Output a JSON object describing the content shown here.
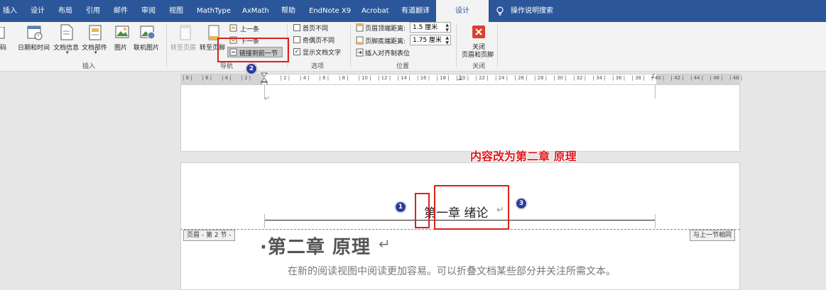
{
  "tabs": [
    {
      "label": "插入",
      "active": false
    },
    {
      "label": "设计",
      "active": false
    },
    {
      "label": "布局",
      "active": false
    },
    {
      "label": "引用",
      "active": false
    },
    {
      "label": "邮件",
      "active": false
    },
    {
      "label": "审阅",
      "active": false
    },
    {
      "label": "视图",
      "active": false
    },
    {
      "label": "MathType",
      "active": false
    },
    {
      "label": "AxMath",
      "active": false
    },
    {
      "label": "帮助",
      "active": false
    },
    {
      "label": "EndNote X9",
      "active": false
    },
    {
      "label": "Acrobat",
      "active": false
    },
    {
      "label": "有道翻译",
      "active": false
    },
    {
      "label": "设计",
      "active": true
    }
  ],
  "search_label": "操作说明搜索",
  "ribbon": {
    "insert_group": {
      "left_cut_label": "码",
      "buttons": [
        "日期和时间",
        "文档信息",
        "文档部件",
        "图片",
        "联机图片"
      ],
      "label": "插入"
    },
    "nav_group": {
      "goto_header": "转至页眉",
      "goto_footer": "转至页脚",
      "prev": "上一条",
      "next": "下一条",
      "link_prev": "链接到前一节",
      "label": "导航"
    },
    "options_group": {
      "checkboxes": [
        {
          "label": "首页不同",
          "checked": false
        },
        {
          "label": "奇偶页不同",
          "checked": false
        },
        {
          "label": "显示文档文字",
          "checked": true
        }
      ],
      "label": "选项"
    },
    "position_group": {
      "header_top_label": "页眉顶端距离:",
      "header_top_value": "1.5 厘米",
      "footer_bottom_label": "页脚底端距离:",
      "footer_bottom_value": "1.75 厘米",
      "align_tab": "插入对齐制表位",
      "label": "位置"
    },
    "close_group": {
      "close_line1": "关闭",
      "close_line2": "页眉和页脚",
      "label": "关闭"
    }
  },
  "ruler_numbers": [
    "8",
    "6",
    "4",
    "2",
    "",
    "2",
    "4",
    "6",
    "8",
    "10",
    "12",
    "14",
    "16",
    "18",
    "20",
    "22",
    "24",
    "26",
    "28",
    "30",
    "32",
    "34",
    "36",
    "38",
    "40",
    "42",
    "44",
    "46",
    "48"
  ],
  "document": {
    "header_text": "第一章 绪论",
    "header_section_tag": "页眉 - 第 2 节 -",
    "same_as_prev_tag": "与上一节相同",
    "chapter_title": "·第二章 原理",
    "body_line": "在新的阅读视图中阅读更加容易。可以折叠文档某些部分并关注所需文本。"
  },
  "annotation": {
    "text": "内容改为第二章 原理",
    "badges": [
      "1",
      "2",
      "3"
    ]
  },
  "colors": {
    "tab_bar": "#2b579a",
    "annotation_red": "#d9221c",
    "badge_blue": "#2a3aa0"
  }
}
